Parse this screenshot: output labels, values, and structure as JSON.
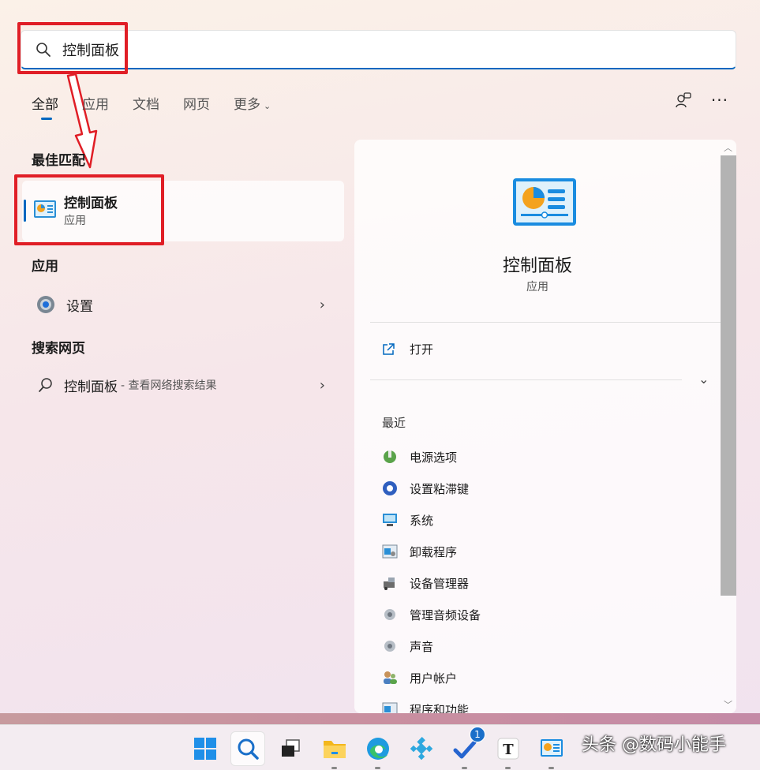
{
  "search": {
    "query": "控制面板"
  },
  "tabs": [
    {
      "label": "全部"
    },
    {
      "label": "应用"
    },
    {
      "label": "文档"
    },
    {
      "label": "网页"
    },
    {
      "label": "更多"
    }
  ],
  "sections": {
    "best_match": "最佳匹配",
    "apps": "应用",
    "web": "搜索网页"
  },
  "best_match": {
    "name": "控制面板",
    "type": "应用"
  },
  "apps": [
    {
      "label": "设置"
    }
  ],
  "web": {
    "label": "控制面板",
    "sub": "- 查看网络搜索结果"
  },
  "detail": {
    "title": "控制面板",
    "subtitle": "应用",
    "open_label": "打开",
    "recent_title": "最近",
    "recent": [
      {
        "label": "电源选项",
        "icon": "power-options-icon"
      },
      {
        "label": "设置粘滞键",
        "icon": "sticky-keys-icon"
      },
      {
        "label": "系统",
        "icon": "system-icon"
      },
      {
        "label": "卸载程序",
        "icon": "uninstall-icon"
      },
      {
        "label": "设备管理器",
        "icon": "device-manager-icon"
      },
      {
        "label": "管理音频设备",
        "icon": "audio-devices-icon"
      },
      {
        "label": "声音",
        "icon": "sound-icon"
      },
      {
        "label": "用户帐户",
        "icon": "user-accounts-icon"
      },
      {
        "label": "程序和功能",
        "icon": "programs-features-icon"
      }
    ]
  },
  "taskbar": {
    "badge_count": "1",
    "items": [
      "windows-start-icon",
      "search-icon",
      "task-view-icon",
      "file-explorer-icon",
      "edge-icon",
      "kodi-icon",
      "todo-icon",
      "typora-icon",
      "control-panel-icon"
    ]
  },
  "watermark": "头条 @数码小能手",
  "colors": {
    "accent": "#0067c0",
    "annotation_red": "#e01e26"
  }
}
